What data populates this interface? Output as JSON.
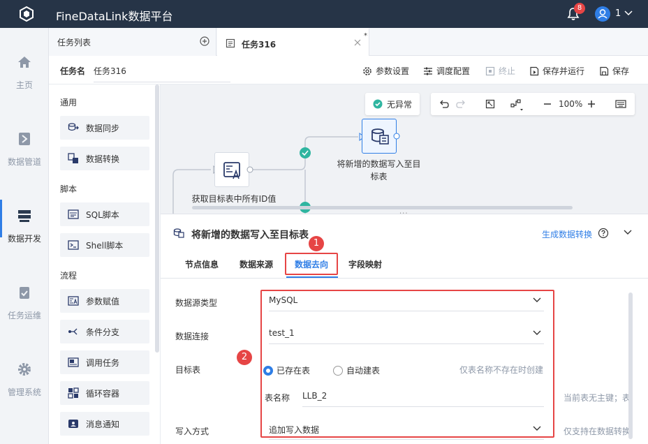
{
  "app": {
    "title": "FineDataLink数据平台",
    "notification_count": "8",
    "user": "1"
  },
  "nav": {
    "items": [
      {
        "label": "主页",
        "icon": "home-icon"
      },
      {
        "label": "数据管道",
        "icon": "pipeline-icon"
      },
      {
        "label": "数据开发",
        "icon": "dev-icon"
      },
      {
        "label": "任务运维",
        "icon": "ops-icon"
      },
      {
        "label": "管理系统",
        "icon": "gear-icon"
      }
    ]
  },
  "tabs": {
    "list_label": "任务列表",
    "active_label": "任务316",
    "modified_mark": "*"
  },
  "toolbar": {
    "task_name_label": "任务名",
    "task_name_value": "任务316",
    "params": "参数设置",
    "schedule": "调度配置",
    "stop": "终止",
    "save_run": "保存并运行",
    "save": "保存"
  },
  "palette": {
    "sections": [
      {
        "title": "通用",
        "items": [
          "数据同步",
          "数据转换"
        ]
      },
      {
        "title": "脚本",
        "items": [
          "SQL脚本",
          "Shell脚本"
        ]
      },
      {
        "title": "流程",
        "items": [
          "参数赋值",
          "条件分支",
          "调用任务",
          "循环容器",
          "消息通知"
        ]
      }
    ]
  },
  "canvas": {
    "status": "无异常",
    "zoom": "100%",
    "node_a": "获取目标表中所有ID值",
    "node_b_line1": "将新增的数据写入至目",
    "node_b_line2": "标表"
  },
  "panel": {
    "title": "将新增的数据写入至目标表",
    "generate": "生成数据转换",
    "tabs": [
      "节点信息",
      "数据来源",
      "数据去向",
      "字段映射"
    ],
    "active_tab": "数据去向",
    "badge1": "1",
    "badge2": "2",
    "fields": {
      "source_type_label": "数据源类型",
      "source_type_value": "MySQL",
      "connection_label": "数据连接",
      "connection_value": "test_1",
      "target_label": "目标表",
      "radio_existing": "已存在表",
      "radio_auto": "自动建表",
      "auto_hint": "仅表名称不存在时创建",
      "table_name_label": "表名称",
      "table_name_value": "LLB_2",
      "pk_hint": "当前表无主键；表",
      "write_label": "写入方式",
      "write_value": "追加写入数据",
      "write_hint": "仅支持在数据转换"
    }
  }
}
